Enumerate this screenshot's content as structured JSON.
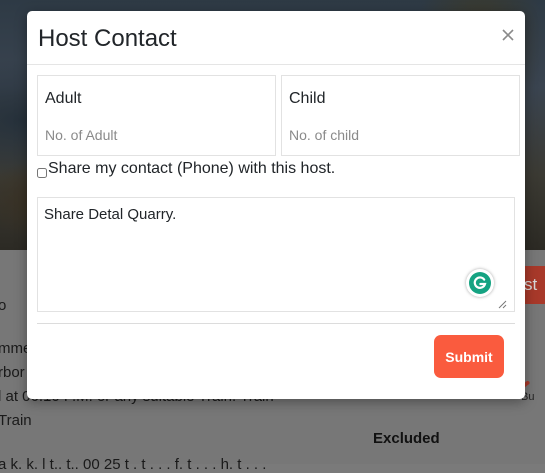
{
  "modal": {
    "title": "Host Contact",
    "close_icon": "close-icon",
    "adult_label": "Adult",
    "adult_placeholder": "No. of Adult",
    "child_label": "Child",
    "child_placeholder": "No. of child",
    "share_label": "Share my contact (Phone) with this host.",
    "share_checked": false,
    "query_value": "Share Detal Quarry.",
    "grammarly_icon": "grammarly-icon",
    "submit_label": "Submit",
    "accent_color": "#fa5b3e"
  },
  "background": {
    "line1": "o",
    "line2": "mme",
    "line3": "rbor",
    "line4": "l at 06.10 P.M. or any suitable Train. Train",
    "line5": "Train",
    "line6": "a k. k. l t.. t.. 00 25 t . t . . . f. t . . . h. t . . .",
    "partial_button": "st",
    "partial_small": "Bu",
    "excluded_label": "Excluded"
  }
}
